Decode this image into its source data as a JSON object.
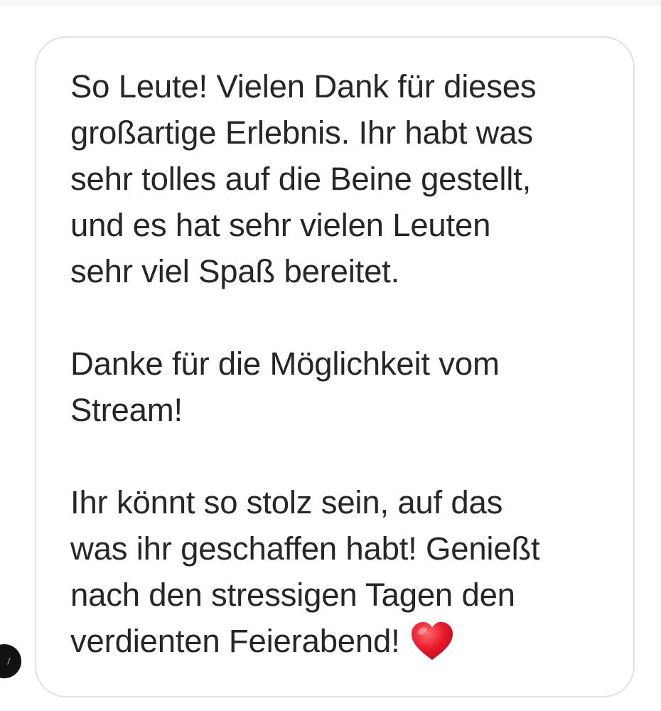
{
  "message": {
    "lines": [
      "So Leute! Vielen Dank für dieses",
      "großartige Erlebnis. Ihr habt was",
      "sehr tolles auf die Beine gestellt,",
      "und es hat sehr vielen Leuten",
      "sehr viel Spaß bereitet.",
      "Danke für die Möglichkeit vom",
      "Stream!",
      "Ihr könnt so stolz sein, auf das",
      "was ihr geschaffen habt! Genießt",
      "nach den stressigen Tagen den",
      "verdienten Feierabend!"
    ],
    "emoji": "red-heart-icon"
  },
  "colors": {
    "text": "#262626",
    "bubble_border": "#e1e1e1",
    "heart": "#e8192c",
    "avatar": "#111111"
  }
}
